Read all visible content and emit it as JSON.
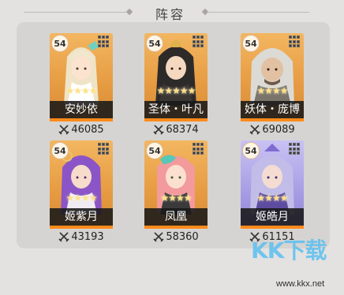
{
  "header": {
    "title": "阵容"
  },
  "lineup": [
    {
      "level": "54",
      "name": "安妙依",
      "power": "46085",
      "stars": "★★★★",
      "bg": "orange"
    },
    {
      "level": "54",
      "name": "圣体・叶凡",
      "power": "68374",
      "stars": "★★★★★",
      "bg": "orange"
    },
    {
      "level": "54",
      "name": "妖体・庞博",
      "power": "69089",
      "stars": "★★★★",
      "bg": "orange"
    },
    {
      "level": "54",
      "name": "姬紫月",
      "power": "43193",
      "stars": "★★★★",
      "bg": "orange"
    },
    {
      "level": "54",
      "name": "凤凰",
      "power": "58360",
      "stars": "★★★★",
      "bg": "orange"
    },
    {
      "level": "54",
      "name": "姬皓月",
      "power": "61151",
      "stars": "★★★★",
      "bg": "blue"
    }
  ],
  "watermark": {
    "logo": "KK下载",
    "url": "www.kkx.net"
  },
  "colors": {
    "accent_bar": "#ff8a1a",
    "card_bg_orange": "#e79d43",
    "card_bg_blue": "#a99fe5"
  }
}
